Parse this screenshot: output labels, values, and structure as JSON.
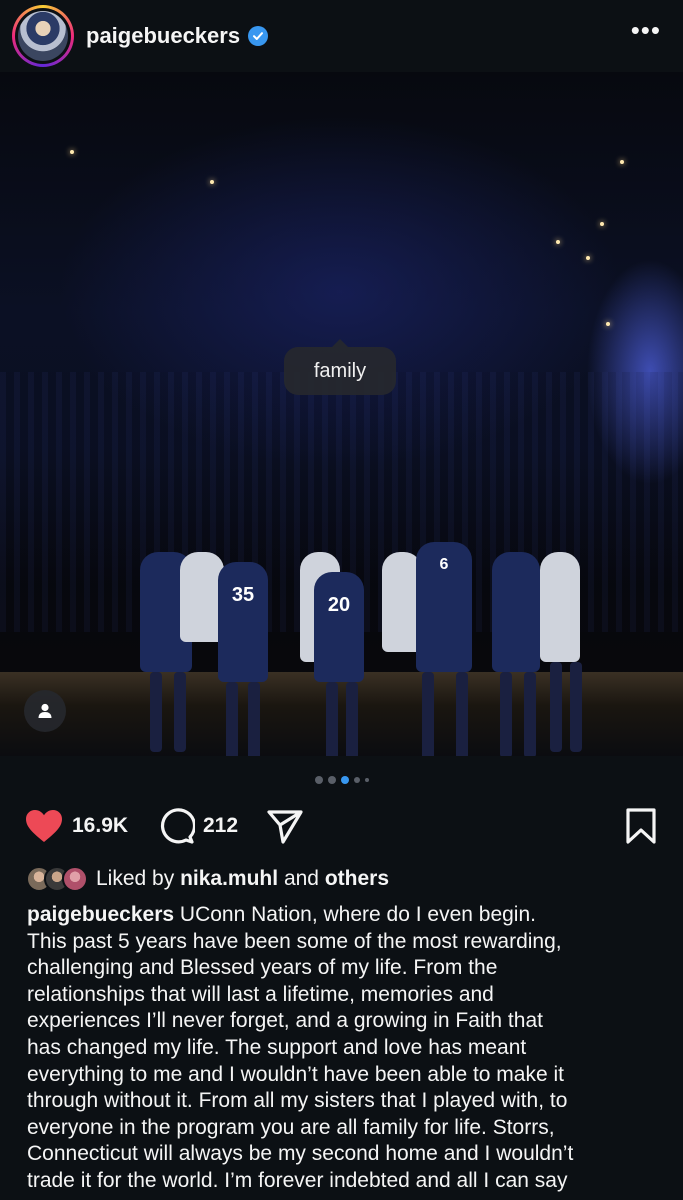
{
  "header": {
    "username": "paigebueckers",
    "more_label": "•••"
  },
  "photo": {
    "tag_label": "family",
    "jersey_numbers": [
      "35",
      "20",
      "6"
    ]
  },
  "carousel": {
    "count": 5,
    "active_index": 2
  },
  "actions": {
    "like_count": "16.9K",
    "comment_count": "212"
  },
  "likes": {
    "prefix": "Liked by",
    "user": "nika.muhl",
    "joiner": "and",
    "others": "others"
  },
  "caption": {
    "author": "paigebueckers",
    "first_line": "UConn Nation, where do I even begin.",
    "lines": [
      "This past 5 years have been some of the most rewarding,",
      "challenging and Blessed years of my life.  From the",
      "relationships that will last a lifetime, memories and",
      "experiences I’ll never forget, and a growing in Faith that",
      "has changed my life. The support and love has meant",
      "everything to me and I wouldn’t have been able to make it",
      "through without it. From all my sisters that I played with, to",
      "everyone in the program you are all family for life. Storrs,",
      "Connecticut will always be my second home and I wouldn’t",
      "trade it for the world. I’m forever indebted and all I can say"
    ]
  },
  "colors": {
    "background": "#0c1014",
    "like_red": "#ed4956",
    "verified_blue": "#3897f0",
    "dot_active": "#3897f0"
  },
  "icons": [
    "verified-badge-icon",
    "more-options-icon",
    "user-tag-icon",
    "heart-icon",
    "comment-icon",
    "share-icon",
    "bookmark-icon"
  ]
}
